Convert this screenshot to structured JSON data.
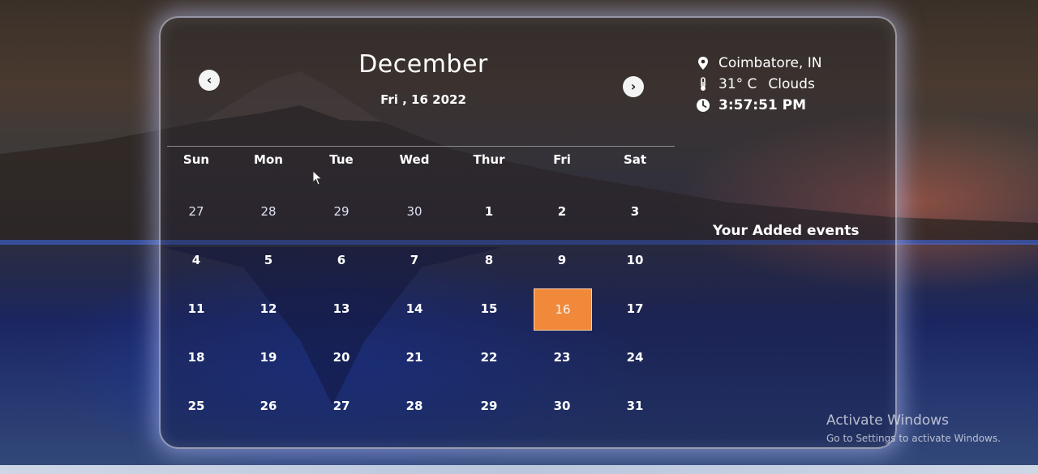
{
  "calendar": {
    "month": "December",
    "date_line": "Fri , 16 2022",
    "prev_icon": "chevron-left-icon",
    "next_icon": "chevron-right-icon",
    "weekdays": [
      "Sun",
      "Mon",
      "Tue",
      "Wed",
      "Thur",
      "Fri",
      "Sat"
    ],
    "weeks": [
      [
        "27",
        "28",
        "29",
        "30",
        "1",
        "2",
        "3"
      ],
      [
        "4",
        "5",
        "6",
        "7",
        "8",
        "9",
        "10"
      ],
      [
        "11",
        "12",
        "13",
        "14",
        "15",
        "16",
        "17"
      ],
      [
        "18",
        "19",
        "20",
        "21",
        "22",
        "23",
        "24"
      ],
      [
        "25",
        "26",
        "27",
        "28",
        "29",
        "30",
        "31"
      ]
    ],
    "selected_day": "16",
    "highlight_color": "#f08a3a"
  },
  "info": {
    "location": "Coimbatore, IN",
    "location_icon": "map-pin-icon",
    "temperature": "31° C",
    "condition": "Clouds",
    "weather_icon": "thermometer-icon",
    "time": "3:57:51 PM",
    "time_icon": "clock-icon"
  },
  "events": {
    "title": "Your Added events"
  },
  "watermark": {
    "title": "Activate Windows",
    "subtitle": "Go to Settings to activate Windows."
  }
}
